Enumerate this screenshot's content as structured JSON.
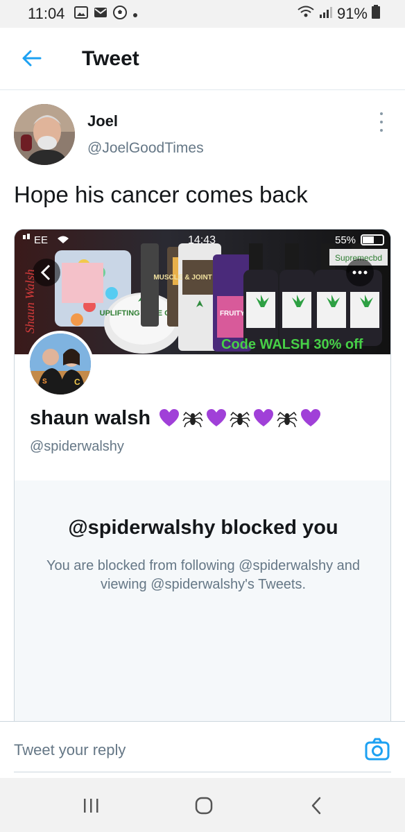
{
  "status_bar": {
    "time": "11:04",
    "left_icons": [
      "image-icon",
      "mail-icon",
      "soccer-ball-icon",
      "dot-icon"
    ],
    "battery": "91%"
  },
  "app_bar": {
    "title": "Tweet"
  },
  "tweet": {
    "author_name": "Joel",
    "author_handle": "@JoelGoodTimes",
    "text": "Hope his cancer comes back"
  },
  "profile_card": {
    "banner": {
      "carrier": "EE",
      "time": "14:43",
      "battery": "55%",
      "brand": "Supremecbd",
      "signature": "Shaun Walsh",
      "tin_label": "UPLIFTING FACE CARE",
      "tub_label": "MUSCLE & JOINT CBD RUB",
      "bottle_label": "FRUITY",
      "promo_text": "Code WALSH 30% off"
    },
    "name": "shaun walsh",
    "name_emoji": [
      "purple-heart",
      "spider",
      "purple-heart",
      "spider",
      "purple-heart",
      "spider",
      "purple-heart"
    ],
    "handle": "@spiderwalshy",
    "blocked_title": "@spiderwalshy blocked you",
    "blocked_body": "You are blocked from following @spiderwalshy and viewing @spiderwalshy's Tweets."
  },
  "reply": {
    "placeholder": "Tweet your reply"
  },
  "colors": {
    "accent": "#1da1f2",
    "text_primary": "#14171a",
    "text_secondary": "#657786",
    "promo_green": "#47d147",
    "purple_heart": "#a040d8"
  }
}
